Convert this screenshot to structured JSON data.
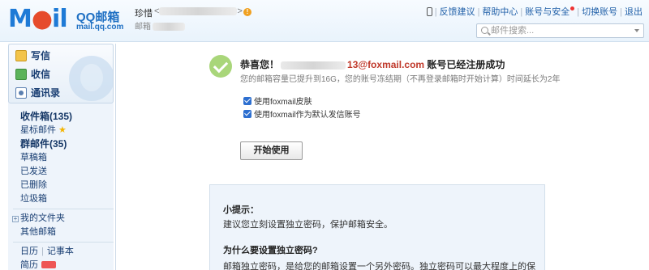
{
  "header": {
    "logo_main": "M",
    "logo_o": "●",
    "logo_il": "il",
    "brand": "QQ邮箱",
    "url": "mail.qq.com",
    "user_name": "珍惜",
    "user_addr_open": "<",
    "user_addr_close": ">",
    "user_sub": "邮箱",
    "warn": "!",
    "top_links": [
      "反馈建议",
      "帮助中心",
      "账号与安全",
      "切换账号",
      "退出"
    ],
    "search_placeholder": "邮件搜索..."
  },
  "sidebar": {
    "compose": "写信",
    "receive": "收信",
    "contacts": "通讯录",
    "folders": [
      {
        "label": "收件箱(135)"
      },
      {
        "label": "星标邮件"
      },
      {
        "label": "群邮件(35)"
      },
      {
        "label": "草稿箱"
      },
      {
        "label": "已发送"
      },
      {
        "label": "已删除"
      },
      {
        "label": "垃圾箱"
      }
    ],
    "my_folders": "我的文件夹",
    "other_mailbox": "其他邮箱",
    "calendar": "日历",
    "notebook": "记事本",
    "next_item": "简历"
  },
  "main": {
    "headline_prefix": "恭喜您！",
    "headline_email": "13@foxmail.com",
    "headline_suffix": " 账号已经注册成功",
    "subline": "您的邮箱容量已提升到16G，您的账号冻结期（不再登录邮箱时开始计算）时间延长为2年",
    "option1": "使用foxmail皮肤",
    "option2": "使用foxmail作为默认发信账号",
    "start_button": "开始使用",
    "tips_title": "小提示：",
    "tips_line": "建议您立刻设置独立密码，保护邮箱安全。",
    "tips_question": "为什么要设置独立密码?",
    "tips_answer": "邮箱独立密码，是给您的邮箱设置一个另外密码。独立密码可以最大程度上的保"
  }
}
